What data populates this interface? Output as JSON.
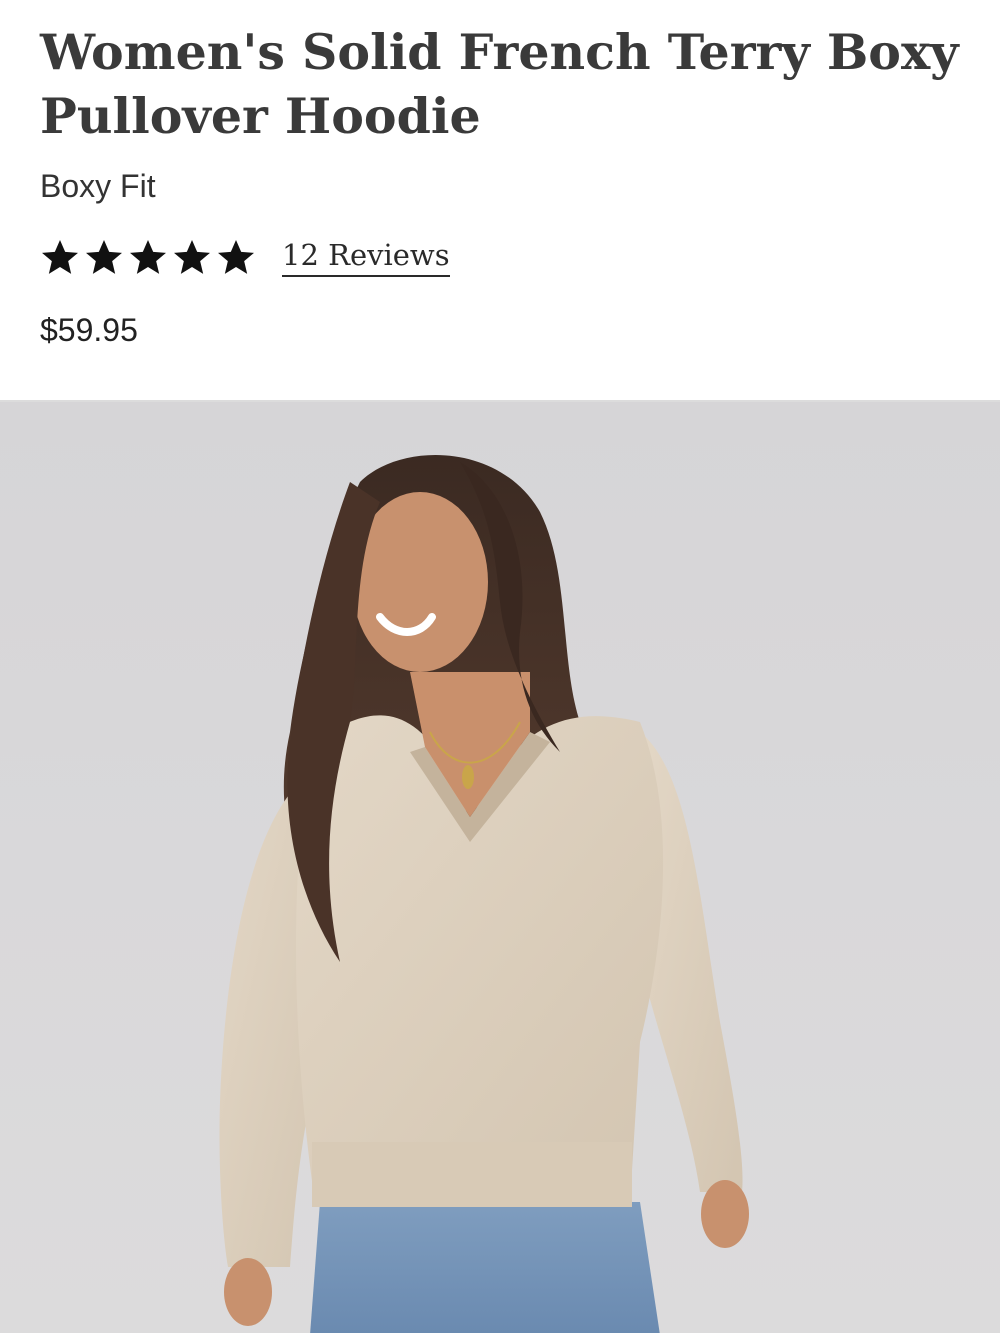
{
  "product": {
    "title": "Women's Solid French Terry Boxy Pullover Hoodie",
    "fit": "Boxy Fit",
    "rating": 5,
    "rating_max": 5,
    "reviews_label": "12 Reviews",
    "price": "$59.95"
  },
  "colors": {
    "title": "#3a3a3a",
    "star": "#111111",
    "image_background": "#d7d6d8",
    "hoodie": "#dccfbd"
  },
  "icons": {
    "star": "star-icon"
  }
}
